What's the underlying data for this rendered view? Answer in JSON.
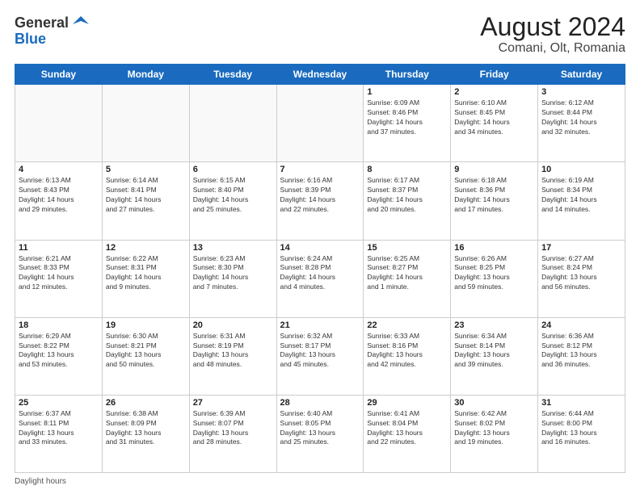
{
  "header": {
    "logo_general": "General",
    "logo_blue": "Blue",
    "month_year": "August 2024",
    "location": "Comani, Olt, Romania"
  },
  "days_of_week": [
    "Sunday",
    "Monday",
    "Tuesday",
    "Wednesday",
    "Thursday",
    "Friday",
    "Saturday"
  ],
  "weeks": [
    [
      {
        "day": "",
        "info": ""
      },
      {
        "day": "",
        "info": ""
      },
      {
        "day": "",
        "info": ""
      },
      {
        "day": "",
        "info": ""
      },
      {
        "day": "1",
        "info": "Sunrise: 6:09 AM\nSunset: 8:46 PM\nDaylight: 14 hours\nand 37 minutes."
      },
      {
        "day": "2",
        "info": "Sunrise: 6:10 AM\nSunset: 8:45 PM\nDaylight: 14 hours\nand 34 minutes."
      },
      {
        "day": "3",
        "info": "Sunrise: 6:12 AM\nSunset: 8:44 PM\nDaylight: 14 hours\nand 32 minutes."
      }
    ],
    [
      {
        "day": "4",
        "info": "Sunrise: 6:13 AM\nSunset: 8:43 PM\nDaylight: 14 hours\nand 29 minutes."
      },
      {
        "day": "5",
        "info": "Sunrise: 6:14 AM\nSunset: 8:41 PM\nDaylight: 14 hours\nand 27 minutes."
      },
      {
        "day": "6",
        "info": "Sunrise: 6:15 AM\nSunset: 8:40 PM\nDaylight: 14 hours\nand 25 minutes."
      },
      {
        "day": "7",
        "info": "Sunrise: 6:16 AM\nSunset: 8:39 PM\nDaylight: 14 hours\nand 22 minutes."
      },
      {
        "day": "8",
        "info": "Sunrise: 6:17 AM\nSunset: 8:37 PM\nDaylight: 14 hours\nand 20 minutes."
      },
      {
        "day": "9",
        "info": "Sunrise: 6:18 AM\nSunset: 8:36 PM\nDaylight: 14 hours\nand 17 minutes."
      },
      {
        "day": "10",
        "info": "Sunrise: 6:19 AM\nSunset: 8:34 PM\nDaylight: 14 hours\nand 14 minutes."
      }
    ],
    [
      {
        "day": "11",
        "info": "Sunrise: 6:21 AM\nSunset: 8:33 PM\nDaylight: 14 hours\nand 12 minutes."
      },
      {
        "day": "12",
        "info": "Sunrise: 6:22 AM\nSunset: 8:31 PM\nDaylight: 14 hours\nand 9 minutes."
      },
      {
        "day": "13",
        "info": "Sunrise: 6:23 AM\nSunset: 8:30 PM\nDaylight: 14 hours\nand 7 minutes."
      },
      {
        "day": "14",
        "info": "Sunrise: 6:24 AM\nSunset: 8:28 PM\nDaylight: 14 hours\nand 4 minutes."
      },
      {
        "day": "15",
        "info": "Sunrise: 6:25 AM\nSunset: 8:27 PM\nDaylight: 14 hours\nand 1 minute."
      },
      {
        "day": "16",
        "info": "Sunrise: 6:26 AM\nSunset: 8:25 PM\nDaylight: 13 hours\nand 59 minutes."
      },
      {
        "day": "17",
        "info": "Sunrise: 6:27 AM\nSunset: 8:24 PM\nDaylight: 13 hours\nand 56 minutes."
      }
    ],
    [
      {
        "day": "18",
        "info": "Sunrise: 6:29 AM\nSunset: 8:22 PM\nDaylight: 13 hours\nand 53 minutes."
      },
      {
        "day": "19",
        "info": "Sunrise: 6:30 AM\nSunset: 8:21 PM\nDaylight: 13 hours\nand 50 minutes."
      },
      {
        "day": "20",
        "info": "Sunrise: 6:31 AM\nSunset: 8:19 PM\nDaylight: 13 hours\nand 48 minutes."
      },
      {
        "day": "21",
        "info": "Sunrise: 6:32 AM\nSunset: 8:17 PM\nDaylight: 13 hours\nand 45 minutes."
      },
      {
        "day": "22",
        "info": "Sunrise: 6:33 AM\nSunset: 8:16 PM\nDaylight: 13 hours\nand 42 minutes."
      },
      {
        "day": "23",
        "info": "Sunrise: 6:34 AM\nSunset: 8:14 PM\nDaylight: 13 hours\nand 39 minutes."
      },
      {
        "day": "24",
        "info": "Sunrise: 6:36 AM\nSunset: 8:12 PM\nDaylight: 13 hours\nand 36 minutes."
      }
    ],
    [
      {
        "day": "25",
        "info": "Sunrise: 6:37 AM\nSunset: 8:11 PM\nDaylight: 13 hours\nand 33 minutes."
      },
      {
        "day": "26",
        "info": "Sunrise: 6:38 AM\nSunset: 8:09 PM\nDaylight: 13 hours\nand 31 minutes."
      },
      {
        "day": "27",
        "info": "Sunrise: 6:39 AM\nSunset: 8:07 PM\nDaylight: 13 hours\nand 28 minutes."
      },
      {
        "day": "28",
        "info": "Sunrise: 6:40 AM\nSunset: 8:05 PM\nDaylight: 13 hours\nand 25 minutes."
      },
      {
        "day": "29",
        "info": "Sunrise: 6:41 AM\nSunset: 8:04 PM\nDaylight: 13 hours\nand 22 minutes."
      },
      {
        "day": "30",
        "info": "Sunrise: 6:42 AM\nSunset: 8:02 PM\nDaylight: 13 hours\nand 19 minutes."
      },
      {
        "day": "31",
        "info": "Sunrise: 6:44 AM\nSunset: 8:00 PM\nDaylight: 13 hours\nand 16 minutes."
      }
    ]
  ],
  "footer": {
    "note": "Daylight hours"
  }
}
